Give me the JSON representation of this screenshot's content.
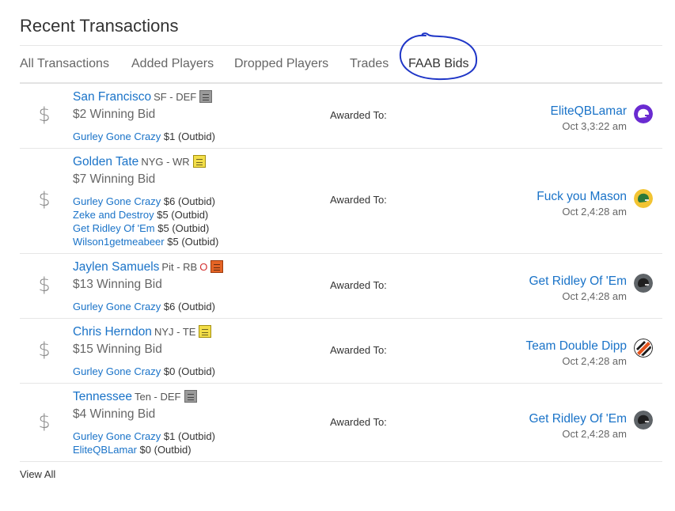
{
  "page": {
    "title": "Recent Transactions",
    "view_all_label": "View All"
  },
  "tabs": [
    {
      "label": "All Transactions"
    },
    {
      "label": "Added Players"
    },
    {
      "label": "Dropped Players"
    },
    {
      "label": "Trades"
    },
    {
      "label": "FAAB Bids",
      "active": true
    }
  ],
  "colors": {
    "link": "#1a73c8",
    "annotation_circle": "#1f36c7",
    "status_out": "#d32f2f"
  },
  "transactions": [
    {
      "player": "San Francisco",
      "meta": "SF - DEF",
      "status": "",
      "note_color": "gray",
      "winning_bid": "$2 Winning Bid",
      "bids": [
        {
          "team": "Gurley Gone Crazy",
          "amount": "$1 (Outbid)"
        }
      ],
      "awarded_label": "Awarded To:",
      "winner": "EliteQBLamar",
      "date": "Oct 3,3:22 am",
      "avatar_icon": "purple-helmet-icon"
    },
    {
      "player": "Golden Tate",
      "meta": "NYG - WR",
      "status": "",
      "note_color": "yellow",
      "winning_bid": "$7 Winning Bid",
      "bids": [
        {
          "team": "Gurley Gone Crazy",
          "amount": "$6 (Outbid)"
        },
        {
          "team": "Zeke and Destroy",
          "amount": "$5 (Outbid)"
        },
        {
          "team": "Get Ridley Of 'Em",
          "amount": "$5 (Outbid)"
        },
        {
          "team": "Wilson1getmeabeer",
          "amount": "$5 (Outbid)"
        }
      ],
      "awarded_label": "Awarded To:",
      "winner": "Fuck you Mason",
      "date": "Oct 2,4:28 am",
      "avatar_icon": "green-helmet-icon"
    },
    {
      "player": "Jaylen Samuels",
      "meta": "Pit - RB",
      "status": "O",
      "note_color": "orange",
      "winning_bid": "$13 Winning Bid",
      "bids": [
        {
          "team": "Gurley Gone Crazy",
          "amount": "$6 (Outbid)"
        }
      ],
      "awarded_label": "Awarded To:",
      "winner": "Get Ridley Of 'Em",
      "date": "Oct 2,4:28 am",
      "avatar_icon": "gray-helmet-icon"
    },
    {
      "player": "Chris Herndon",
      "meta": "NYJ - TE",
      "status": "",
      "note_color": "yellow",
      "winning_bid": "$15 Winning Bid",
      "bids": [
        {
          "team": "Gurley Gone Crazy",
          "amount": "$0 (Outbid)"
        }
      ],
      "awarded_label": "Awarded To:",
      "winner": "Team Double Dipp",
      "date": "Oct 2,4:28 am",
      "avatar_icon": "orange-black-stripe-icon"
    },
    {
      "player": "Tennessee",
      "meta": "Ten - DEF",
      "status": "",
      "note_color": "gray",
      "winning_bid": "$4 Winning Bid",
      "bids": [
        {
          "team": "Gurley Gone Crazy",
          "amount": "$1 (Outbid)"
        },
        {
          "team": "EliteQBLamar",
          "amount": "$0 (Outbid)"
        }
      ],
      "awarded_label": "Awarded To:",
      "winner": "Get Ridley Of 'Em",
      "date": "Oct 2,4:28 am",
      "avatar_icon": "gray-helmet-icon"
    }
  ]
}
